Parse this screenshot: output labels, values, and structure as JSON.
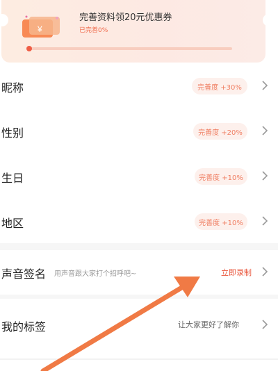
{
  "banner": {
    "title": "完善资料领20元优惠券",
    "progress_text": "已完善0%",
    "progress_value": 0,
    "coupon_text": "¥"
  },
  "rows": [
    {
      "label": "昵称",
      "badge": "完善度 +30%"
    },
    {
      "label": "性别",
      "badge": "完善度 +20%"
    },
    {
      "label": "生日",
      "badge": "完善度 +10%"
    },
    {
      "label": "地区",
      "badge": "完善度 +10%"
    }
  ],
  "voice": {
    "label": "声音签名",
    "hint": "用声音跟大家打个招呼吧~",
    "action": "立即录制"
  },
  "tags": {
    "label": "我的标签",
    "hint": "让大家更好了解你"
  },
  "colors": {
    "accent": "#ef5d45",
    "annotation_arrow": "#f07a45"
  }
}
